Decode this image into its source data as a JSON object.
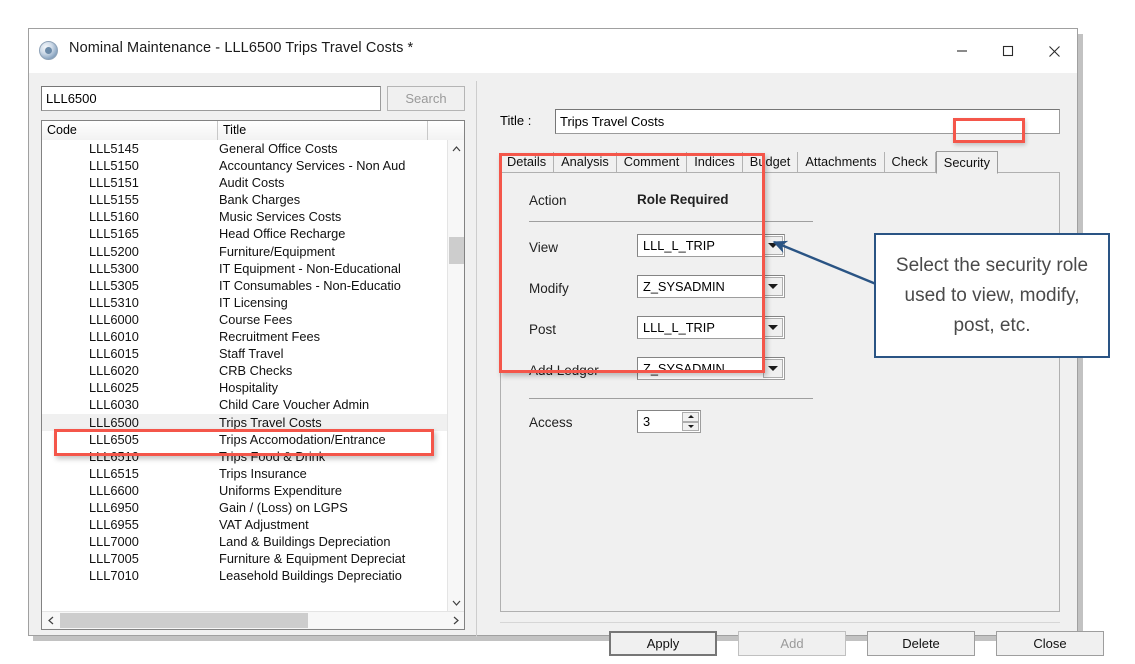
{
  "window": {
    "title": "Nominal Maintenance - LLL6500 Trips Travel Costs *",
    "icon": "app-circle-icon",
    "controls": {
      "minimize": "minimize-icon",
      "maximize": "maximize-icon",
      "close": "close-icon"
    }
  },
  "search": {
    "value": "LLL6500",
    "placeholder": "",
    "button_label": "Search"
  },
  "list": {
    "columns": [
      "Code",
      "Title"
    ],
    "rows": [
      {
        "code": "LLL5145",
        "title": "General Office Costs"
      },
      {
        "code": "LLL5150",
        "title": "Accountancy Services - Non Aud"
      },
      {
        "code": "LLL5151",
        "title": "Audit Costs"
      },
      {
        "code": "LLL5155",
        "title": "Bank Charges"
      },
      {
        "code": "LLL5160",
        "title": "Music Services Costs"
      },
      {
        "code": "LLL5165",
        "title": "Head Office Recharge"
      },
      {
        "code": "LLL5200",
        "title": "Furniture/Equipment"
      },
      {
        "code": "LLL5300",
        "title": "IT Equipment - Non-Educational"
      },
      {
        "code": "LLL5305",
        "title": "IT Consumables - Non-Educatio"
      },
      {
        "code": "LLL5310",
        "title": "IT Licensing"
      },
      {
        "code": "LLL6000",
        "title": "Course Fees"
      },
      {
        "code": "LLL6010",
        "title": "Recruitment Fees"
      },
      {
        "code": "LLL6015",
        "title": "Staff Travel"
      },
      {
        "code": "LLL6020",
        "title": "CRB Checks"
      },
      {
        "code": "LLL6025",
        "title": "Hospitality"
      },
      {
        "code": "LLL6030",
        "title": "Child Care Voucher Admin"
      },
      {
        "code": "LLL6500",
        "title": "Trips Travel Costs",
        "selected": true
      },
      {
        "code": "LLL6505",
        "title": "Trips Accomodation/Entrance"
      },
      {
        "code": "LLL6510",
        "title": "Trips Food & Drink"
      },
      {
        "code": "LLL6515",
        "title": "Trips Insurance"
      },
      {
        "code": "LLL6600",
        "title": "Uniforms Expenditure"
      },
      {
        "code": "LLL6950",
        "title": "Gain / (Loss) on LGPS"
      },
      {
        "code": "LLL6955",
        "title": "VAT Adjustment"
      },
      {
        "code": "LLL7000",
        "title": "Land & Buildings Depreciation"
      },
      {
        "code": "LLL7005",
        "title": "Furniture & Equipment Depreciat"
      },
      {
        "code": "LLL7010",
        "title": "Leasehold Buildings Depreciatio"
      }
    ]
  },
  "detail": {
    "title_label": "Title :",
    "title_value": "Trips Travel Costs",
    "tabs": [
      {
        "label": "Details",
        "active": false
      },
      {
        "label": "Analysis",
        "active": false
      },
      {
        "label": "Comment",
        "active": false
      },
      {
        "label": "Indices",
        "active": false
      },
      {
        "label": "Budget",
        "active": false
      },
      {
        "label": "Attachments",
        "active": false
      },
      {
        "label": "Check",
        "active": false
      },
      {
        "label": "Security",
        "active": true
      }
    ],
    "security": {
      "header_action": "Action",
      "header_role": "Role Required",
      "rows": [
        {
          "action": "View",
          "role": "LLL_L_TRIP"
        },
        {
          "action": "Modify",
          "role": "Z_SYSADMIN"
        },
        {
          "action": "Post",
          "role": "LLL_L_TRIP"
        },
        {
          "action": "Add Ledger",
          "role": "Z_SYSADMIN"
        }
      ],
      "access_label": "Access",
      "access_value": "3"
    }
  },
  "footer": {
    "buttons": [
      {
        "label": "Apply",
        "state": "default"
      },
      {
        "label": "Add",
        "state": "disabled"
      },
      {
        "label": "Delete",
        "state": "normal"
      },
      {
        "label": "Close",
        "state": "normal"
      }
    ]
  },
  "annotations": {
    "callout_text": "Select the security role used to view, modify, post, etc.",
    "highlight_color": "#f4564a",
    "callout_border_color": "#2a5484"
  }
}
